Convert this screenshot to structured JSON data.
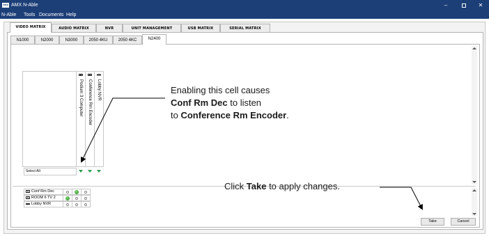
{
  "window": {
    "title": "AMX N-Able",
    "app_icon_text": "AMX"
  },
  "menu": [
    "N-Able",
    "Tools",
    "Documents",
    "Help"
  ],
  "main_tabs": [
    "VIDEO MATRIX",
    "AUDIO MATRIX",
    "NVR",
    "UNIT MANAGEMENT",
    "USB MATRIX",
    "SERIAL MATRIX"
  ],
  "active_main_tab": "VIDEO MATRIX",
  "sub_tabs": [
    "N1000",
    "N2000",
    "N3000",
    "2050 4KU",
    "2050 4KC",
    "N2400"
  ],
  "active_sub_tab": "N2400",
  "matrix": {
    "columns": [
      "Podium 3 Computer",
      "Conference Rm Encoder",
      "Lobby NVR"
    ],
    "select_all_label": "Select All:",
    "rows": [
      {
        "label": "Conf Rm Dec",
        "cells": [
          false,
          true,
          false
        ]
      },
      {
        "label": "ROOM 6 TV 2",
        "cells": [
          true,
          false,
          false
        ]
      },
      {
        "label": "Lobby NVR",
        "cells": [
          false,
          false,
          false
        ]
      }
    ]
  },
  "buttons": {
    "take": "Take",
    "cancel": "Cancel"
  },
  "callouts": {
    "cell": {
      "line1": "Enabling this cell causes",
      "line2_bold": "Conf Rm Dec",
      "line2_rest": " to listen",
      "line3_pre": "to ",
      "line3_bold": "Conference Rm Encoder",
      "line3_post": "."
    },
    "take": {
      "pre": "Click ",
      "bold": "Take",
      "post": " to apply changes."
    }
  },
  "colors": {
    "titlebar": "#1c3f78",
    "enabled_dot": "#2f8e2a",
    "select_arrow": "#2e9e4f"
  }
}
